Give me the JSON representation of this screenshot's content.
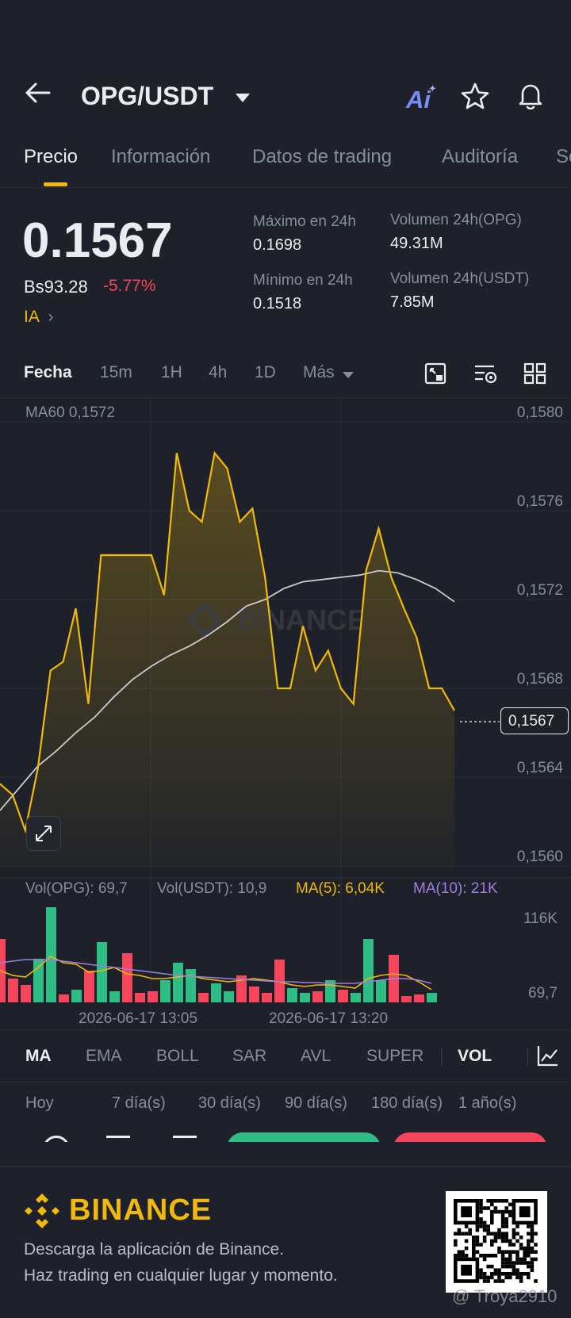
{
  "header": {
    "pair": "OPG/USDT",
    "ai_label": "Ai"
  },
  "tabs": [
    "Precio",
    "Información",
    "Datos de trading",
    "Auditoría",
    "Se"
  ],
  "price": {
    "last": "0.1567",
    "fiat": "Bs93.28",
    "change": "-5.77%",
    "ia": "IA",
    "high_label": "Máximo en 24h",
    "high": "0.1698",
    "low_label": "Mínimo en 24h",
    "low": "0.1518",
    "vol_base_label": "Volumen 24h(OPG)",
    "vol_base": "49.31M",
    "vol_quote_label": "Volumen 24h(USDT)",
    "vol_quote": "7.85M"
  },
  "intervals": [
    "Fecha",
    "15m",
    "1H",
    "4h",
    "1D",
    "Más"
  ],
  "chart": {
    "ma60_label": "MA60 0,1572",
    "y_labels": [
      "0,1580",
      "0,1576",
      "0,1572",
      "0,1568",
      "0,1564",
      "0,1560"
    ],
    "current_price_tag": "0,1567",
    "watermark": "BINANCE",
    "vol_opg": "Vol(OPG): 69,7",
    "vol_usdt": "Vol(USDT): 10,9",
    "ma5": "MA(5): 6,04K",
    "ma10": "MA(10): 21K",
    "vol_y_labels": [
      "116K",
      "69,7"
    ],
    "x_labels": [
      "2026-06-17 13:05",
      "2026-06-17 13:20"
    ]
  },
  "chart_data": {
    "type": "line",
    "title": "",
    "ylim": [
      0.156,
      0.158
    ],
    "series": [
      {
        "name": "",
        "values": [
          0.15637,
          0.15632,
          0.15616,
          0.15644,
          0.15688,
          0.15692,
          0.15716,
          0.15673,
          0.1574,
          0.1574,
          0.1574,
          0.1574,
          0.1574,
          0.15722,
          0.15786,
          0.1576,
          0.15755,
          0.15786,
          0.15779,
          0.15755,
          0.15761,
          0.1573,
          0.1568,
          0.1568,
          0.15708,
          0.15688,
          0.15697,
          0.1568,
          0.15673,
          0.15733,
          0.15752,
          0.1573,
          0.15716,
          0.15703,
          0.1568,
          0.1568,
          0.1567
        ]
      },
      {
        "name": "MA60",
        "values": [
          0.15625,
          0.15635,
          0.15645,
          0.15652,
          0.1566,
          0.15667,
          0.15676,
          0.15684,
          0.1569,
          0.15695,
          0.15699,
          0.15704,
          0.1571,
          0.15717,
          0.1572,
          0.15725,
          0.15728,
          0.15729,
          0.1573,
          0.15731,
          0.15733,
          0.15732,
          0.15729,
          0.15725,
          0.15719
        ]
      }
    ],
    "volume_ma_labels": [
      "MA(5)",
      "MA(10)"
    ]
  },
  "indicators": [
    "MA",
    "EMA",
    "BOLL",
    "SAR",
    "AVL",
    "SUPER",
    "VOL"
  ],
  "periods": [
    "Hoy",
    "7 día(s)",
    "30 día(s)",
    "90 día(s)",
    "180 día(s)",
    "1 año(s)"
  ],
  "footer": {
    "brand": "BINANCE",
    "line1": "Descarga la aplicación de Binance.",
    "line2": "Haz trading en cualquier lugar y momento.",
    "watermark_user": "@ Troya2910"
  },
  "colors": {
    "accent": "#f0b90b",
    "down": "#f6465d",
    "up": "#2ebd85",
    "ma10": "#9c7ee0",
    "bg": "#1e2129"
  }
}
